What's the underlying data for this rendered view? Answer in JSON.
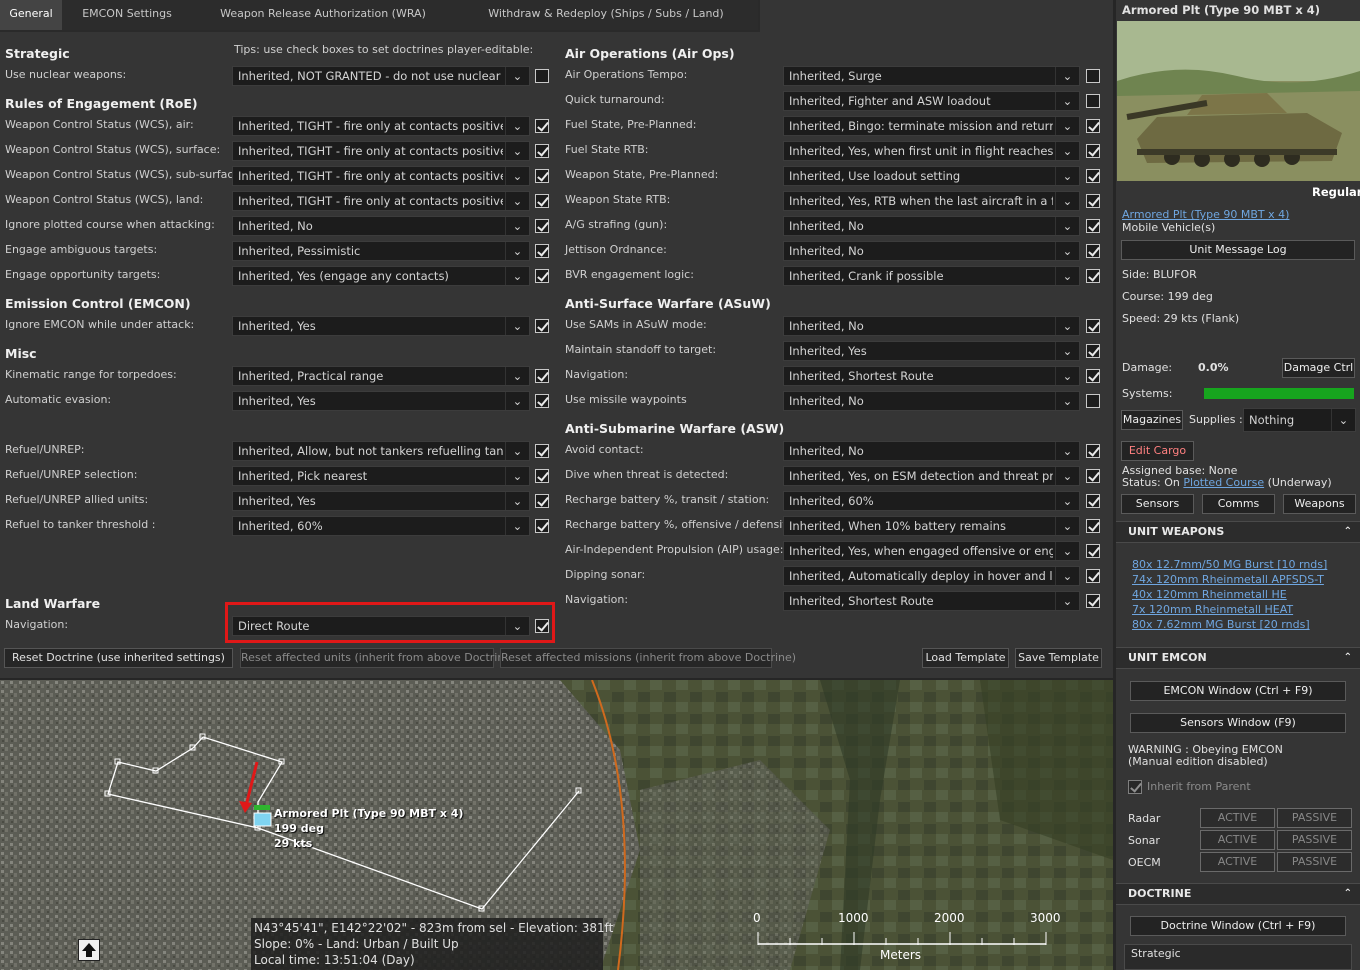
{
  "tabs": [
    "General",
    "EMCON Settings",
    "Weapon Release Authorization (WRA)",
    "Withdraw & Redeploy (Ships / Subs / Land)"
  ],
  "tips": "Tips: use check boxes to set doctrines player-editable:",
  "sections": {
    "strategic": "Strategic",
    "roe": "Rules of Engagement (RoE)",
    "emcon": "Emission Control (EMCON)",
    "misc": "Misc",
    "land": "Land Warfare",
    "airops": "Air Operations (Air Ops)",
    "asuw": "Anti-Surface Warfare (ASuW)",
    "asw": "Anti-Submarine Warfare (ASW)"
  },
  "left_rows": [
    {
      "label": "Use nuclear weapons:",
      "value": "Inherited, NOT GRANTED - do not use nuclear w",
      "checked": false
    },
    {
      "label": "Weapon Control Status (WCS), air:",
      "value": "Inherited, TIGHT - fire only at contacts positively i",
      "checked": true
    },
    {
      "label": "Weapon Control Status (WCS), surface:",
      "value": "Inherited, TIGHT - fire only at contacts positively i",
      "checked": true
    },
    {
      "label": "Weapon Control Status (WCS), sub-surface:",
      "value": "Inherited, TIGHT - fire only at contacts positively i",
      "checked": true
    },
    {
      "label": "Weapon Control Status (WCS), land:",
      "value": "Inherited, TIGHT - fire only at contacts positively i",
      "checked": true
    },
    {
      "label": "Ignore plotted course when attacking:",
      "value": "Inherited, No",
      "checked": true
    },
    {
      "label": "Engage ambiguous targets:",
      "value": "Inherited, Pessimistic",
      "checked": true
    },
    {
      "label": "Engage opportunity targets:",
      "value": "Inherited, Yes (engage any contacts)",
      "checked": true
    },
    {
      "label": "Ignore EMCON while under attack:",
      "value": "Inherited, Yes",
      "checked": true
    },
    {
      "label": "Kinematic range for torpedoes:",
      "value": "Inherited, Practical range",
      "checked": true
    },
    {
      "label": "Automatic evasion:",
      "value": "Inherited, Yes",
      "checked": true
    },
    {
      "label": "Refuel/UNREP:",
      "value": "Inherited, Allow, but not tankers refuelling tanker",
      "checked": true
    },
    {
      "label": "Refuel/UNREP selection:",
      "value": "Inherited, Pick nearest",
      "checked": true
    },
    {
      "label": "Refuel/UNREP allied units:",
      "value": "Inherited, Yes",
      "checked": true
    },
    {
      "label": "Refuel to tanker threshold :",
      "value": "Inherited, 60%",
      "checked": true
    },
    {
      "label": "Navigation:",
      "value": "Direct Route",
      "checked": true
    }
  ],
  "right_rows": [
    {
      "label": "Air Operations Tempo:",
      "value": "Inherited, Surge",
      "checked": false
    },
    {
      "label": "Quick turnaround:",
      "value": "Inherited, Fighter and ASW loadout",
      "checked": false
    },
    {
      "label": "Fuel State, Pre-Planned:",
      "value": "Inherited, Bingo: terminate mission and return to",
      "checked": true
    },
    {
      "label": "Fuel State RTB:",
      "value": "Inherited, Yes, when first unit in flight reaches fue",
      "checked": true
    },
    {
      "label": "Weapon State, Pre-Planned:",
      "value": "Inherited, Use loadout setting",
      "checked": true
    },
    {
      "label": "Weapon State RTB:",
      "value": "Inherited, Yes, RTB when the last aircraft in a fligh",
      "checked": true
    },
    {
      "label": "A/G strafing (gun):",
      "value": "Inherited, No",
      "checked": true
    },
    {
      "label": "Jettison Ordnance:",
      "value": "Inherited, No",
      "checked": true
    },
    {
      "label": "BVR engagement logic:",
      "value": "Inherited, Crank if possible",
      "checked": true
    },
    {
      "label": "Use SAMs in ASuW mode:",
      "value": "Inherited, No",
      "checked": true
    },
    {
      "label": "Maintain standoff to target:",
      "value": "Inherited, Yes",
      "checked": true
    },
    {
      "label": "Navigation:",
      "value": "Inherited, Shortest Route",
      "checked": true
    },
    {
      "label": "Use missile waypoints",
      "value": "Inherited, No",
      "checked": false
    },
    {
      "label": "Avoid contact:",
      "value": "Inherited, No",
      "checked": true
    },
    {
      "label": "Dive when threat is detected:",
      "value": "Inherited, Yes, on ESM detection and threat proxi",
      "checked": true
    },
    {
      "label": "Recharge battery %, transit / station:",
      "value": "Inherited, 60%",
      "checked": true
    },
    {
      "label": "Recharge battery %, offensive / defensive:",
      "value": "Inherited, When 10% battery remains",
      "checked": true
    },
    {
      "label": "Air-Independent Propulsion (AIP) usage:",
      "value": "Inherited, Yes, when engaged offensive or engag",
      "checked": true
    },
    {
      "label": "Dipping sonar:",
      "value": "Inherited, Automatically deploy in hover and less",
      "checked": true
    },
    {
      "label": "Navigation:",
      "value": "Inherited, Shortest Route",
      "checked": true
    }
  ],
  "bottom_buttons": {
    "reset_doctrine": "Reset Doctrine (use inherited settings)",
    "reset_units": "Reset affected units (inherit from above Doctrine)",
    "reset_missions": "Reset affected missions (inherit from above Doctrine)",
    "load_template": "Load Template",
    "save_template": "Save Template"
  },
  "map": {
    "unit_name": "Armored Plt (Type 90 MBT x 4)",
    "unit_course": "199 deg",
    "unit_speed": "29 kts",
    "info1": "N43°45'41\", E142°22'02\" - 823m from sel - Elevation: 381ft",
    "info2": "Slope: 0%  - Land: Urban / Built Up",
    "info3": "Local time: 13:51:04 (Day)",
    "scale_ticks": [
      "0",
      "1000",
      "2000",
      "3000"
    ],
    "scale_unit": "Meters"
  },
  "unit": {
    "title": "Armored Plt (Type 90 MBT x 4)",
    "proficiency": "Regular",
    "link": "Armored Plt (Type 90 MBT x 4)",
    "type": "Mobile Vehicle(s)",
    "message_log": "Unit Message Log",
    "side": "Side: BLUFOR",
    "course": "Course: 199 deg",
    "speed": "Speed: 29 kts (Flank)",
    "damage_label": "Damage:",
    "damage_value": "0.0%",
    "damage_ctrl": "Damage Ctrl",
    "systems_label": "Systems:",
    "systems_health": 1.0,
    "magazines": "Magazines",
    "supplies_label": "Supplies :",
    "supplies_value": "Nothing",
    "edit_cargo": "Edit Cargo",
    "assigned_base": "Assigned base: None",
    "status_prefix": "Status: On ",
    "status_link": "Plotted Course",
    "status_suffix": " (Underway)",
    "sensors": "Sensors",
    "comms": "Comms",
    "weapons": "Weapons"
  },
  "unit_weapons": {
    "header": "UNIT WEAPONS",
    "items": [
      "80x 12.7mm/50 MG Burst [10 rnds]",
      "74x 120mm Rheinmetall APFSDS-T",
      "40x 120mm Rheinmetall HE",
      "7x 120mm Rheinmetall HEAT",
      "80x 7.62mm MG Burst [20 rnds]"
    ]
  },
  "unit_emcon": {
    "header": "UNIT EMCON",
    "emcon_window": "EMCON Window (Ctrl + F9)",
    "sensors_window": "Sensors Window (F9)",
    "warning1": "WARNING : Obeying EMCON",
    "warning2": "(Manual edition disabled)",
    "inherit": "Inherit from Parent",
    "rows": [
      {
        "label": "Radar",
        "active": "ACTIVE",
        "passive": "PASSIVE"
      },
      {
        "label": "Sonar",
        "active": "ACTIVE",
        "passive": "PASSIVE"
      },
      {
        "label": "OECM",
        "active": "ACTIVE",
        "passive": "PASSIVE"
      }
    ]
  },
  "doctrine": {
    "header": "DOCTRINE",
    "window": "Doctrine Window (Ctrl + F9)",
    "strategic": "Strategic"
  },
  "colors": {
    "accent_red": "#e01818",
    "systems_green": "#17a51e",
    "link_blue": "#6fa6e0"
  }
}
